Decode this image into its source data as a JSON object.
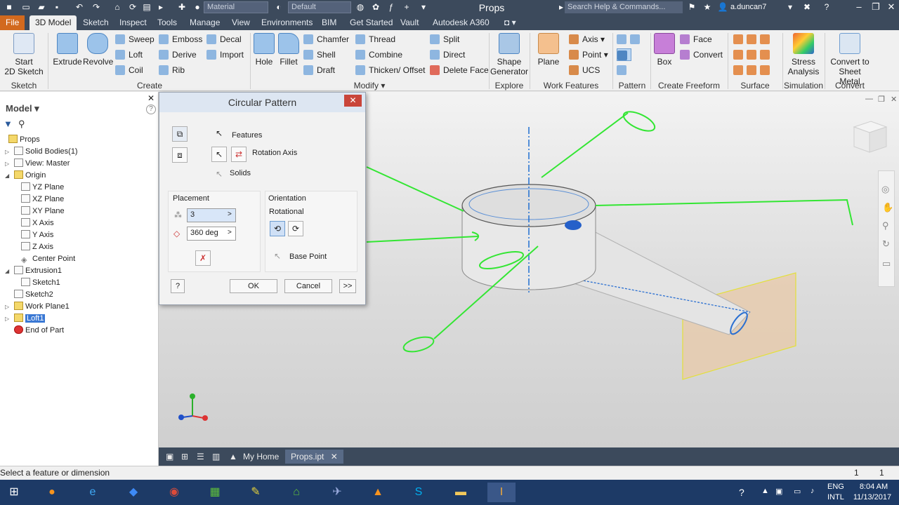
{
  "titlebar": {
    "material_combo": "Material",
    "appearance_combo": "Default",
    "title": "Props",
    "search_placeholder": "Search Help & Commands...",
    "user": "a.duncan7"
  },
  "tabs": [
    "File",
    "3D Model",
    "Sketch",
    "Inspect",
    "Tools",
    "Manage",
    "View",
    "Environments",
    "BIM",
    "Get Started",
    "Vault",
    "Autodesk A360"
  ],
  "active_tab": "3D Model",
  "ribbon": {
    "sketch": {
      "title": "Sketch",
      "start_line1": "Start",
      "start_line2": "2D Sketch"
    },
    "create": {
      "title": "Create",
      "extrude": "Extrude",
      "revolve": "Revolve",
      "sweep": "Sweep",
      "loft": "Loft",
      "coil": "Coil",
      "emboss": "Emboss",
      "derive": "Derive",
      "rib": "Rib",
      "decal": "Decal",
      "import": "Import"
    },
    "modify": {
      "title": "Modify",
      "hole": "Hole",
      "fillet": "Fillet",
      "chamfer": "Chamfer",
      "shell": "Shell",
      "draft": "Draft",
      "thread": "Thread",
      "combine": "Combine",
      "thicken": "Thicken/ Offset",
      "split": "Split",
      "direct": "Direct",
      "delete_face": "Delete Face"
    },
    "explore": {
      "title": "Explore",
      "shape_line1": "Shape",
      "shape_line2": "Generator"
    },
    "work_features": {
      "title": "Work Features",
      "plane": "Plane",
      "axis": "Axis",
      "point": "Point",
      "ucs": "UCS"
    },
    "pattern": {
      "title": "Pattern"
    },
    "create_freeform": {
      "title": "Create Freeform",
      "box": "Box",
      "face": "Face",
      "convert": "Convert"
    },
    "surface": {
      "title": "Surface"
    },
    "simulation": {
      "title": "Simulation",
      "line1": "Stress",
      "line2": "Analysis"
    },
    "convert": {
      "title": "Convert",
      "line1": "Convert to",
      "line2": "Sheet Metal"
    }
  },
  "browser": {
    "header": "Model",
    "nodes": [
      "Props",
      "Solid Bodies(1)",
      "View: Master",
      "Origin",
      "YZ Plane",
      "XZ Plane",
      "XY Plane",
      "X Axis",
      "Y Axis",
      "Z Axis",
      "Center Point",
      "Extrusion1",
      "Sketch1",
      "Sketch2",
      "Work Plane1",
      "Loft1",
      "End of Part"
    ]
  },
  "dialog": {
    "title": "Circular Pattern",
    "features": "Features",
    "rotation_axis": "Rotation Axis",
    "solids": "Solids",
    "placement": "Placement",
    "count_value": "3",
    "angle_value": "360 deg",
    "orientation": "Orientation",
    "rotational": "Rotational",
    "base_point": "Base Point",
    "ok": "OK",
    "cancel": "Cancel",
    "more": ">>"
  },
  "doc_tabs": [
    "My Home",
    "Props.ipt"
  ],
  "status": {
    "message": "Select a feature or dimension",
    "count_1": "1",
    "count_2": "1"
  },
  "tray": {
    "lang_1": "ENG",
    "lang_2": "INTL",
    "time": "8:04 AM",
    "date": "11/13/2017"
  },
  "colors": {
    "accent_file": "#d2691e",
    "sketch_green": "#33e633",
    "axis_blue": "#1f6fd1",
    "workplane": "#e8c9a8"
  }
}
